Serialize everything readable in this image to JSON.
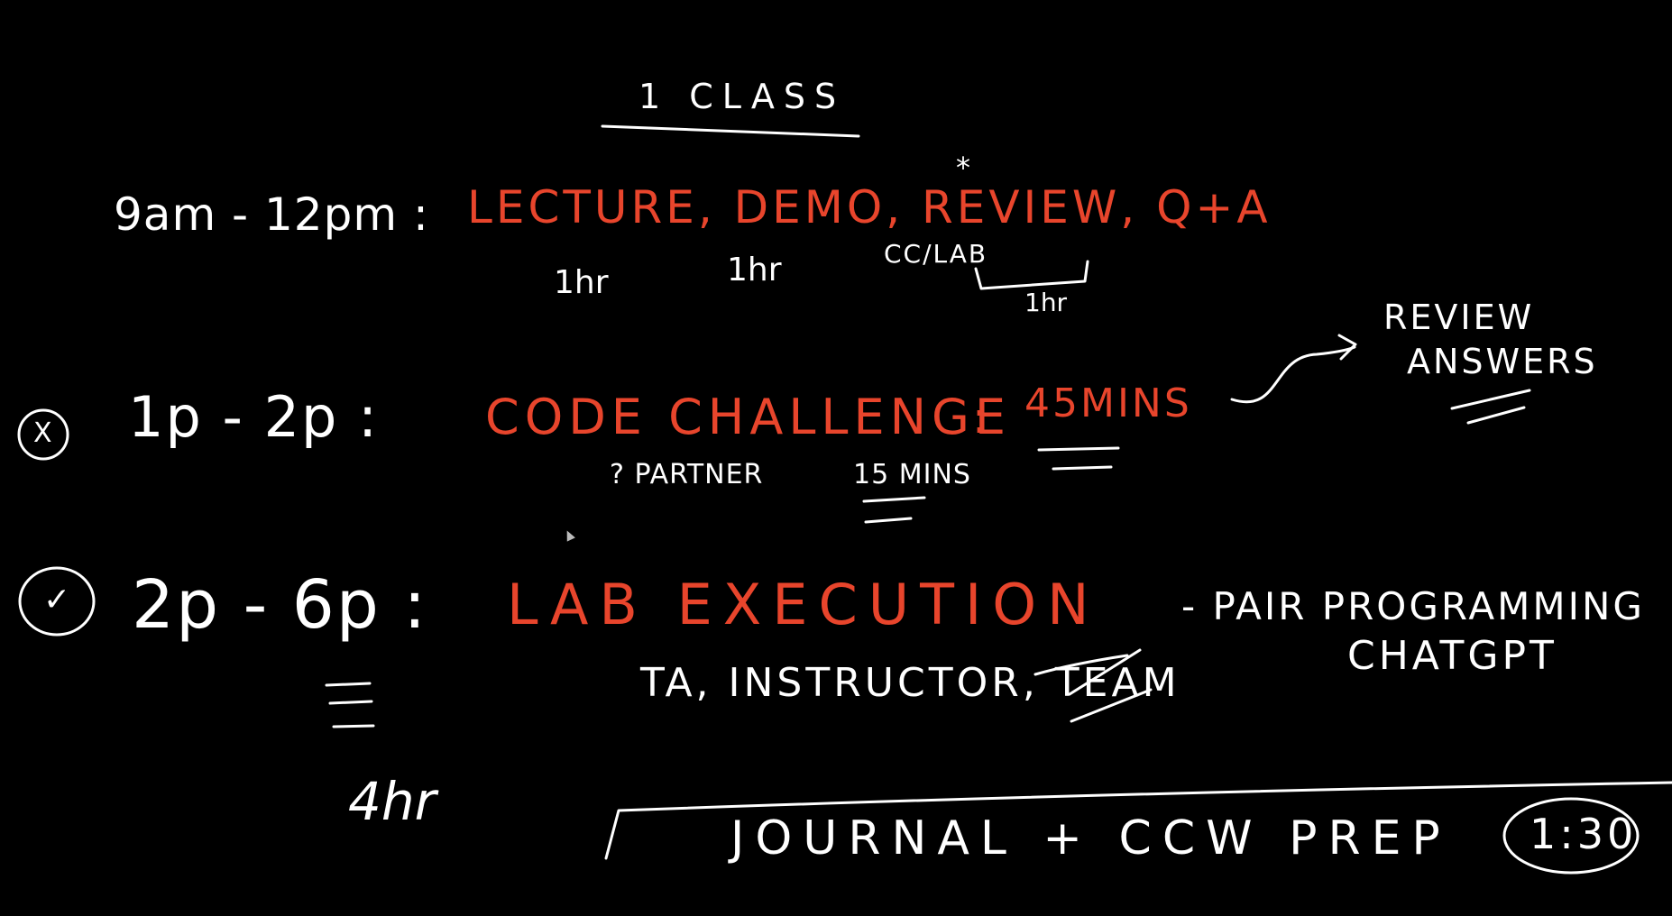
{
  "colors": {
    "background": "#000000",
    "ink_white": "#ffffff",
    "ink_red": "#e8452c"
  },
  "title": "1 CLASS",
  "asterisk": "*",
  "rows": [
    {
      "time": "9am - 12pm :",
      "activity": "LECTURE, DEMO, REVIEW, Q+A",
      "notes": [
        "1hr",
        "1hr",
        "CC/LAB",
        "1hr"
      ]
    },
    {
      "mark_icon": "x-circle-icon",
      "mark": "X",
      "time": "1p - 2p :",
      "activity": "CODE CHALLENGE",
      "separator": ":",
      "duration": "45MINS",
      "notes": [
        "? PARTNER",
        "15 MINS"
      ],
      "followup": [
        "REVIEW",
        "ANSWERS"
      ]
    },
    {
      "mark_icon": "check-circle-icon",
      "mark": "✓",
      "time": "2p - 6p :",
      "activity": "LAB EXECUTION",
      "support": "TA, INSTRUCTOR, TEAM",
      "support_extra": [
        "- PAIR PROGRAMMING",
        "CHATGPT"
      ],
      "total": "4hr"
    }
  ],
  "footer": {
    "label": "JOURNAL + CCW PREP",
    "badge": "1:30"
  }
}
